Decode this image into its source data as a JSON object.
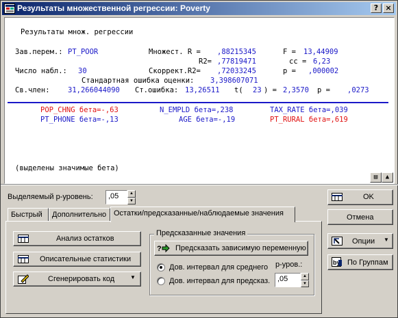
{
  "window": {
    "title": "Результаты множественной регрессии: Poverty",
    "controls": {
      "help": "?",
      "close": "×"
    }
  },
  "results": {
    "heading": "Результаты множ. регрессии",
    "dep_var_label": "Зав.перем.:",
    "dep_var_value": "PT_POOR",
    "multR_label": "Множест. R =",
    "multR_value": ",88215345",
    "F_label": "F =",
    "F_value": "13,44909",
    "R2_label": "R2=",
    "R2_value": ",77819471",
    "df_label": "cc =",
    "df_value": "6,23",
    "n_label": "Число набл.:",
    "n_value": "30",
    "adjR2_label": "Скоррект.R2=",
    "adjR2_value": ",72033245",
    "p_label": "p =",
    "p_value": ",000002",
    "se_label": "Стандартная ошибка оценки:",
    "se_value": "3,398607071",
    "intercept_label": "Св.член:",
    "intercept_value": "31,266044090",
    "se_int_label": "Ст.ошибка:",
    "se_int_value": "13,26511",
    "t_label": "t(",
    "t_df": "23",
    "t_close": ") =",
    "t_value": "2,3570",
    "p2_label": "p =",
    "p2_value": ",0273",
    "betas": [
      {
        "text": "POP_CHNG бета=-,63",
        "color": "#e01010"
      },
      {
        "text": "N_EMPLD бета=,238",
        "color": "#1a18c8"
      },
      {
        "text": "TAX_RATE бета=,039",
        "color": "#1a18c8"
      },
      {
        "text": "PT_PHONE бета=-,13",
        "color": "#1a18c8"
      },
      {
        "text": "AGE бета=-,19",
        "color": "#1a18c8"
      },
      {
        "text": "PT_RURAL бета=,619",
        "color": "#e01010"
      }
    ],
    "note": "(выделены значимые бета)"
  },
  "p_level": {
    "label": "Выделяемый p-уровень:",
    "value": ",05"
  },
  "tabs": [
    {
      "label": "Быстрый"
    },
    {
      "label": "Дополнительно"
    },
    {
      "label": "Остатки/предсказанные/наблюдаемые значения"
    }
  ],
  "buttons": {
    "residuals": "Анализ остатков",
    "descriptive": "Описательные статистики",
    "generate_code": "Сгенерировать код",
    "ok": "OK",
    "cancel": "Отмена",
    "options": "Опции",
    "by_group": "По Группам"
  },
  "predicted": {
    "legend": "Предсказанные значения",
    "predict_button": "Предсказать зависимую переменную",
    "radio_mean": "Дов. интервал для среднего",
    "radio_pred": "Дов. интервал для предсказ.",
    "p_level_label": "р-уров.:",
    "p_level_value": ",05"
  },
  "colors": {
    "accent_blue": "#1a18c8",
    "significant_red": "#e01010",
    "titlebar": "#0a246a"
  }
}
